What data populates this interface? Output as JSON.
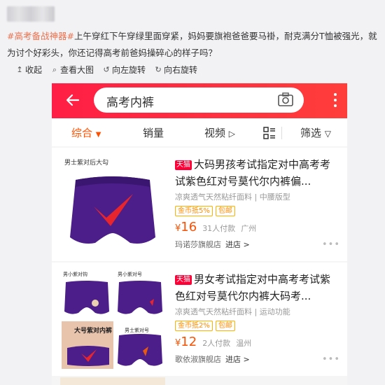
{
  "post": {
    "hashtag": "#高考备战神器#",
    "text": "上午穿红下午穿绿里面穿紧，妈妈要旗袍爸爸要马褂，耐克满分T恤被强光，就为讨个好彩头，你还记得高考前爸妈操碎心的样子吗？"
  },
  "actions": [
    {
      "icon": "collapse-icon",
      "glyph": "↥",
      "label": "收起"
    },
    {
      "icon": "magnifier-icon",
      "glyph": "⌕",
      "label": "查看大图"
    },
    {
      "icon": "rotate-left-icon",
      "glyph": "↺",
      "label": "向左旋转"
    },
    {
      "icon": "rotate-right-icon",
      "glyph": "↻",
      "label": "向右旋转"
    }
  ],
  "shop": {
    "search_query": "高考内裤",
    "sort": [
      "综合",
      "销量",
      "视频",
      "筛选"
    ],
    "products": [
      {
        "image_caption": "男士紫对后大勾",
        "badge": "天猫",
        "title": "大码男孩考试指定对中高考考试紫色红对号莫代尔内裤偏...",
        "desc": "凉爽透气天然粘纤面料 | 中腰版型",
        "promo": "金币抵5%",
        "shipping": "包邮",
        "price": "16",
        "sold": "31人付款",
        "location": "广州",
        "shop_name": "玛诺莎旗舰店",
        "enter": "进店 >"
      },
      {
        "image_caption_1": "男小紫对钩",
        "image_caption_2": "男小紫对号",
        "image_caption_3": "大号紫对内裤",
        "image_caption_4": "男士紫对号",
        "badge": "天猫",
        "title": "男女考试指定对中高考考试紫色红对号莫代尔内裤大码考...",
        "desc": "凉爽透气天然粘纤面料 | 运动功能",
        "promo": "金币抵2%",
        "shipping": "包邮",
        "price": "12",
        "sold": "2人付款",
        "location": "温州",
        "shop_name": "歌依淑旗舰店",
        "enter": "进店 >"
      }
    ],
    "colors": {
      "accent": "#ff2442",
      "price": "#ff5000",
      "purple": "#4b1e8a",
      "check": "#e8252c"
    }
  }
}
